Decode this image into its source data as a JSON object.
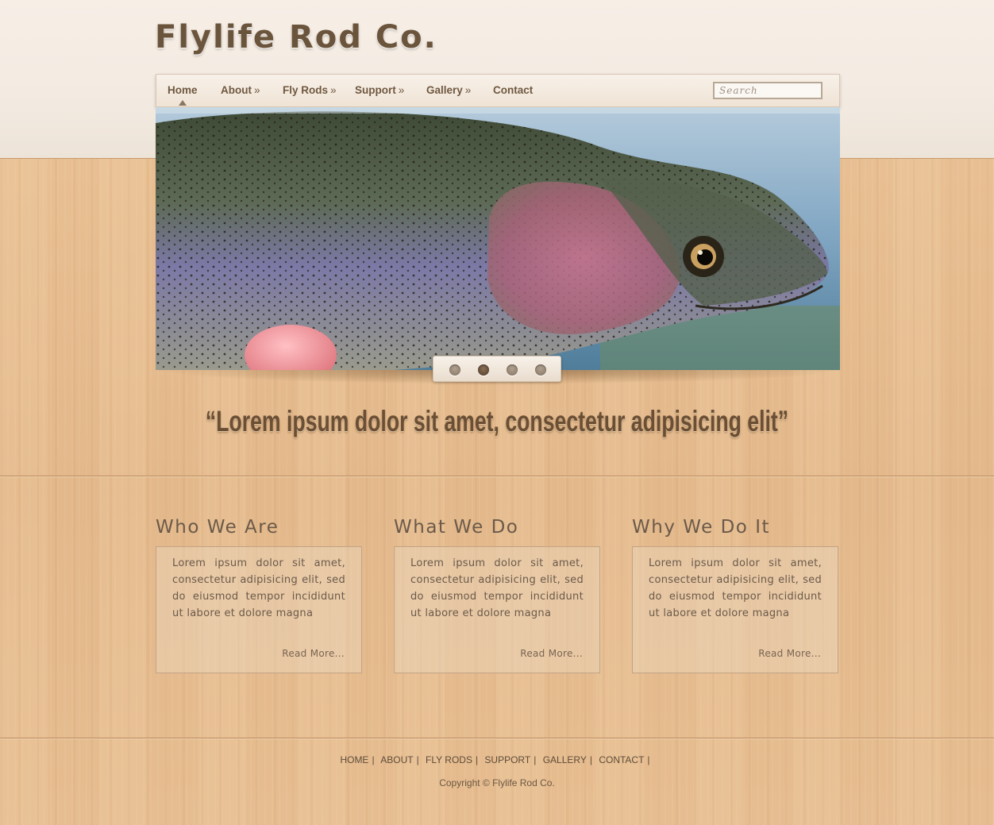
{
  "site": {
    "logo": "Flylife Rod Co."
  },
  "nav": {
    "items": [
      {
        "label": "Home",
        "more": ""
      },
      {
        "label": "About",
        "more": "»"
      },
      {
        "label": "Fly Rods",
        "more": "»"
      },
      {
        "label": "Support",
        "more": "»"
      },
      {
        "label": "Gallery",
        "more": "»"
      },
      {
        "label": "Contact",
        "more": ""
      }
    ],
    "active": "Home",
    "search_placeholder": "Search"
  },
  "hero": {
    "slides": 4,
    "active_slide": 2
  },
  "quote": "“Lorem ipsum dolor sit amet, consectetur adipisicing elit”",
  "columns": [
    {
      "title": "Who We Are",
      "text": "Lorem ipsum dolor sit amet, consectetur adipisicing elit, sed do eiusmod tempor incididunt ut labore et dolore magna",
      "link": "Read More..."
    },
    {
      "title": "What We Do",
      "text": "Lorem ipsum dolor sit amet, consectetur adipisicing elit, sed do eiusmod tempor incididunt ut labore et dolore magna",
      "link": "Read More..."
    },
    {
      "title": "Why We Do It",
      "text": "Lorem ipsum dolor sit amet, consectetur adipisicing elit, sed do eiusmod tempor incididunt ut labore et dolore magna",
      "link": "Read More..."
    }
  ],
  "footer": {
    "links": [
      "HOME",
      "ABOUT",
      "FLY RODS",
      "SUPPORT",
      "GALLERY",
      "CONTACT"
    ],
    "separator": "|",
    "copyright": "Copyright © Flylife Rod Co."
  },
  "colors": {
    "text_brown": "#6b543c",
    "wood": "#e2b98c",
    "header_bg": "#f5ede4"
  }
}
